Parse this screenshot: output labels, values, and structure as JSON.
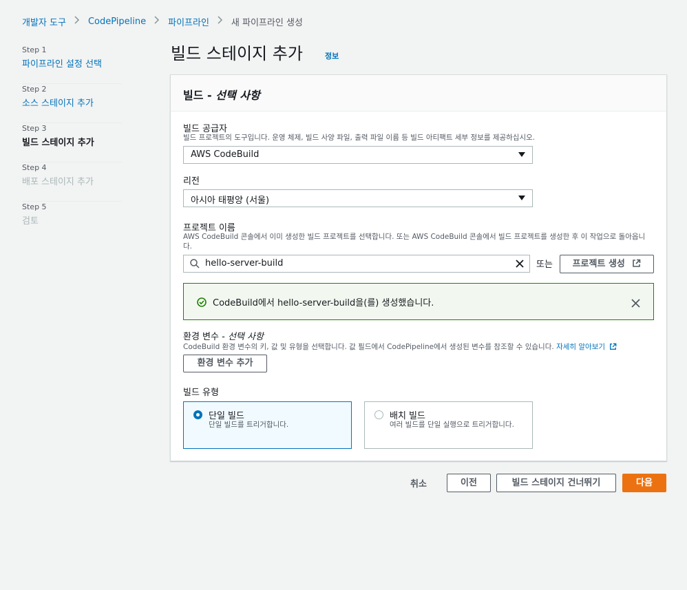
{
  "breadcrumb": {
    "items": [
      "개발자 도구",
      "CodePipeline",
      "파이프라인"
    ],
    "current": "새 파이프라인 생성"
  },
  "steps": [
    {
      "num": "Step 1",
      "title": "파이프라인 설정 선택",
      "state": "link"
    },
    {
      "num": "Step 2",
      "title": "소스 스테이지 추가",
      "state": "link"
    },
    {
      "num": "Step 3",
      "title": "빌드 스테이지 추가",
      "state": "current"
    },
    {
      "num": "Step 4",
      "title": "배포 스테이지 추가",
      "state": "disabled"
    },
    {
      "num": "Step 5",
      "title": "검토",
      "state": "disabled"
    }
  ],
  "page": {
    "title": "빌드 스테이지 추가",
    "info_link": "정보"
  },
  "panel": {
    "title_main": "빌드 - ",
    "title_optional": "선택 사항",
    "provider": {
      "label": "빌드 공급자",
      "description": "빌드 프로젝트의 도구입니다. 운영 체제, 빌드 사양 파일, 출력 파일 이름 등 빌드 아티팩트 세부 정보를 제공하십시오.",
      "value": "AWS CodeBuild"
    },
    "region": {
      "label": "리전",
      "value": "아시아 태평양 (서울)"
    },
    "project": {
      "label": "프로젝트 이름",
      "description": "AWS CodeBuild 콘솔에서 이미 생성한 빌드 프로젝트를 선택합니다. 또는 AWS CodeBuild 콘솔에서 빌드 프로젝트를 생성한 후 이 작업으로 돌아옵니다.",
      "value": "hello-server-build",
      "or_text": "또는",
      "create_button": "프로젝트 생성"
    },
    "alert": {
      "message": "CodeBuild에서 hello-server-build을(를) 생성했습니다."
    },
    "env": {
      "label_main": "환경 변수 - ",
      "label_optional": "선택 사항",
      "description": "CodeBuild 환경 변수의 키, 값 및 유형을 선택합니다. 값 필드에서 CodePipeline에서 생성된 변수를 참조할 수 있습니다.",
      "learn_more": "자세히 알아보기",
      "add_button": "환경 변수 추가"
    },
    "build_type": {
      "label": "빌드 유형",
      "options": [
        {
          "title": "단일 빌드",
          "description": "단일 빌드를 트리거합니다.",
          "selected": true
        },
        {
          "title": "배치 빌드",
          "description": "여러 빌드를 단일 실행으로 트리거합니다.",
          "selected": false
        }
      ]
    }
  },
  "footer": {
    "cancel": "취소",
    "previous": "이전",
    "skip": "빌드 스테이지 건너뛰기",
    "next": "다음"
  },
  "colors": {
    "link": "#0073bb",
    "primary": "#ec7211",
    "success": "#1d8102",
    "background": "#f2f3f3"
  }
}
